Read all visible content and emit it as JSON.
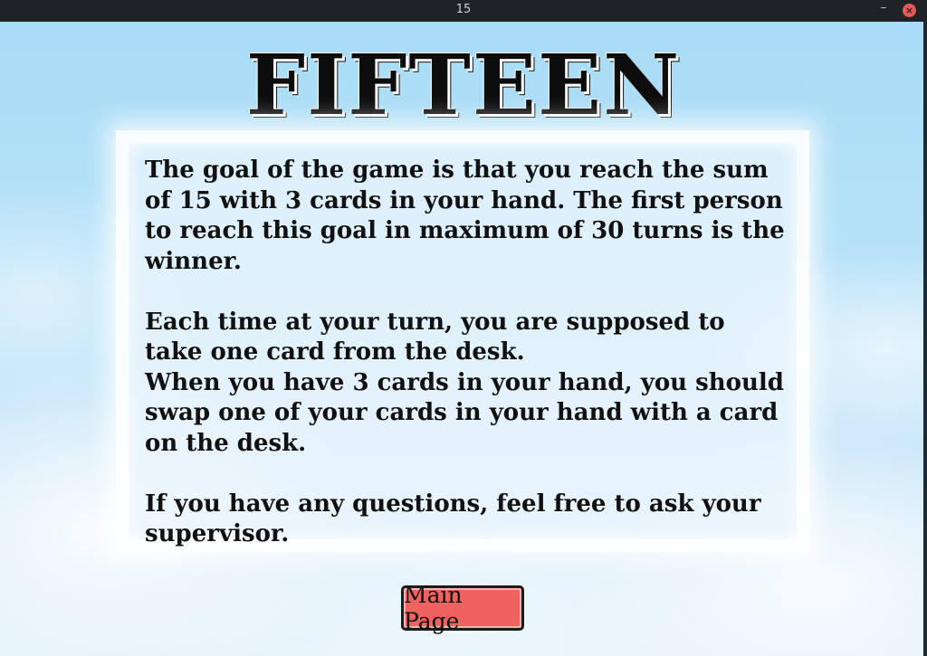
{
  "window": {
    "title": "15",
    "minimize_glyph": "–",
    "close_glyph": "×"
  },
  "game": {
    "title": "FIFTEEN",
    "rules": {
      "paragraph_1": "The goal of the game is that you reach the sum of 15 with 3 cards in your hand. The first person to reach this goal in maximum of 30 turns is the winner.",
      "paragraph_2a": "Each time at your turn, you are supposed to take one card from the desk.",
      "paragraph_2b": "When you have 3 cards in your hand, you should swap one of your cards in your hand with a card on the desk.",
      "paragraph_3": "If you have any questions, feel free to ask your supervisor."
    },
    "main_page_button_label": "Main Page"
  },
  "colors": {
    "button_fill": "#f0625f",
    "close_button": "#e35b5b",
    "titlebar": "#202326"
  }
}
